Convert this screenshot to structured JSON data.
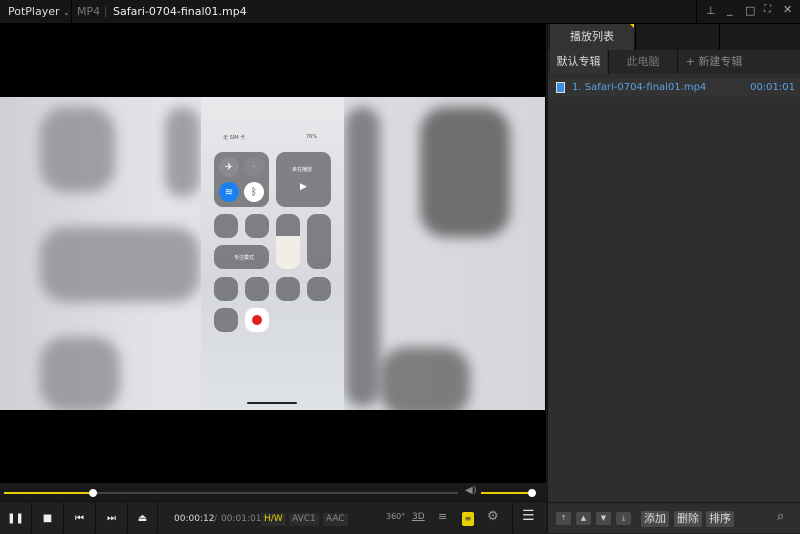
{
  "titlebar": {
    "app": "PotPlayer",
    "format": "MP4",
    "filename": "Safari-0704-final01.mp4"
  },
  "video": {
    "status": "无 SIM 卡",
    "battery": "76%",
    "now_playing": "未在播放",
    "focus": "专注模式"
  },
  "player": {
    "progress": 0.197,
    "volume": 1.0,
    "current_time": "00:00:12",
    "separator": "/",
    "total_time": "00:01:01",
    "hw": "H/W",
    "video_codec": "AVC1",
    "audio_codec": "AAC",
    "btn_360": "360°",
    "btn_3d": "3D"
  },
  "playlist": {
    "tabs": [
      "播放列表"
    ],
    "subtabs": [
      "默认专辑",
      "此电脑",
      "+ 新建专辑"
    ],
    "items": [
      {
        "title": "1. Safari-0704-final01.mp4",
        "duration": "00:01:01"
      }
    ],
    "buttons": {
      "add": "添加",
      "delete": "删除",
      "sort": "排序"
    }
  },
  "colors": {
    "accent": "#e8d000",
    "link": "#5aa0e6"
  }
}
